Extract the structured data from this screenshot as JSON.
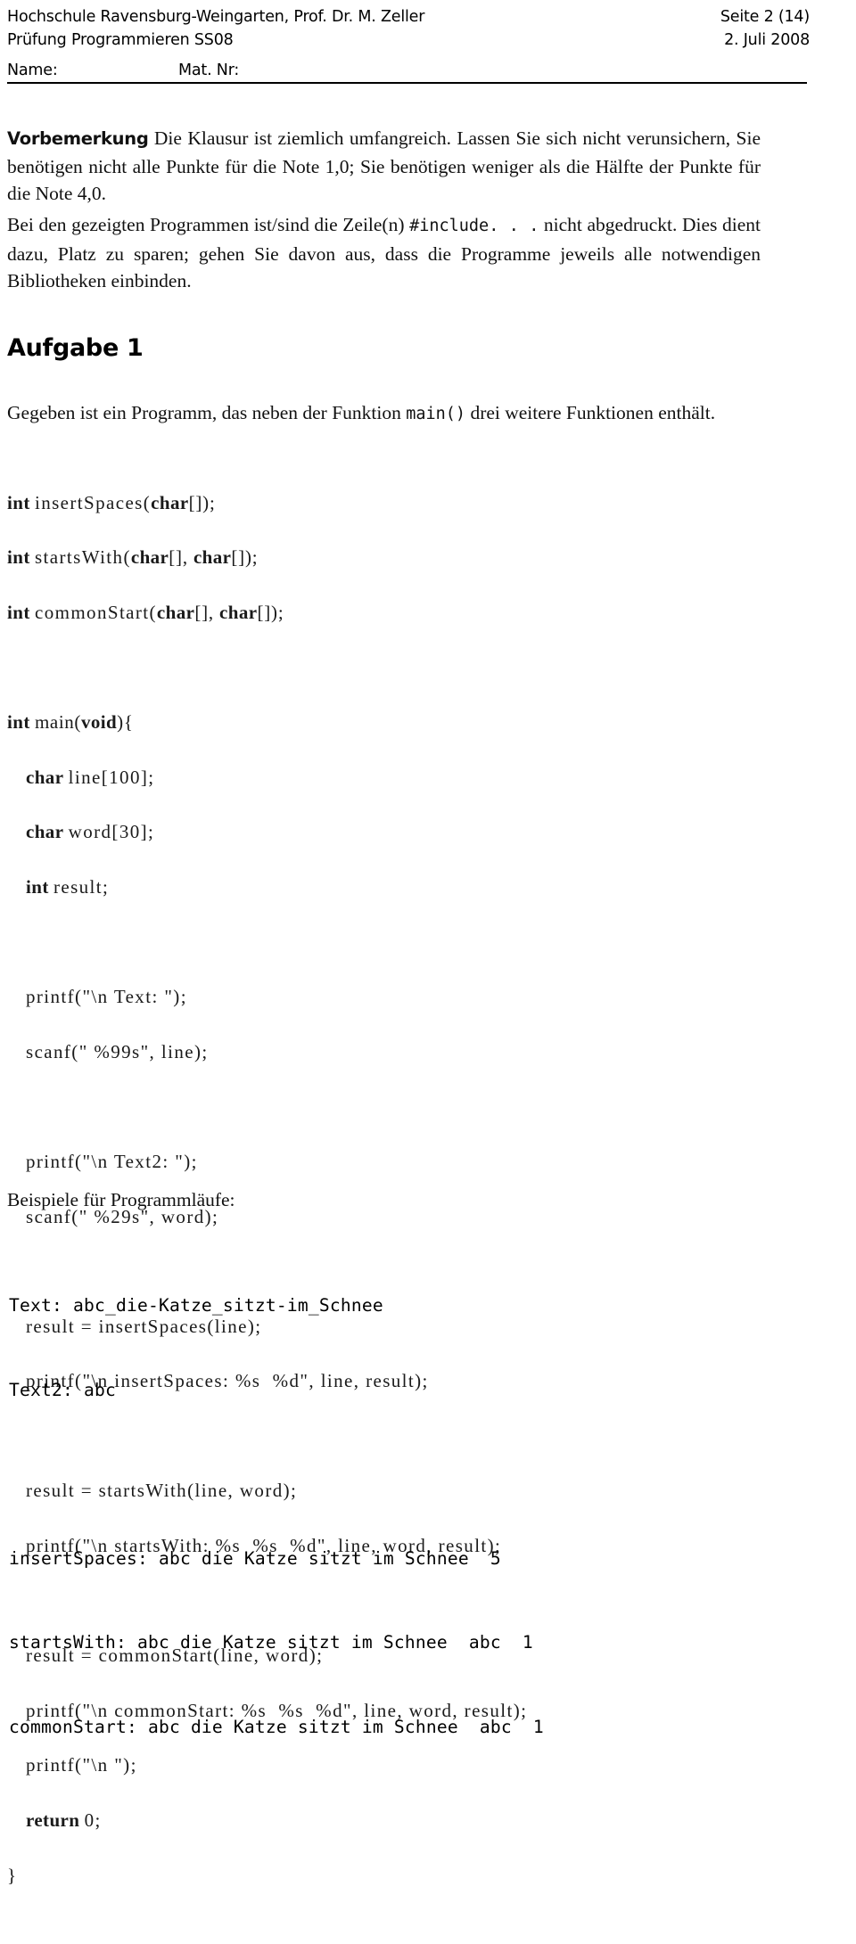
{
  "header": {
    "institution": "Hochschule Ravensburg-Weingarten, Prof. Dr. M. Zeller",
    "exam": "Prüfung Programmieren SS08",
    "page_label": "Seite 2 (14)",
    "date": "2. Juli 2008",
    "name_label": "Name:",
    "matnr_label": "Mat. Nr:"
  },
  "preface": {
    "lead": "Vorbemerkung",
    "text1": "Die Klausur ist ziemlich umfangreich. Lassen Sie sich nicht verunsichern, Sie benötigen nicht alle Punkte für die Note 1,0; Sie benötigen weniger als die Hälfte der Punkte für die Note 4,0.",
    "text2_before": "Bei den gezeigten Programmen ist/sind die Zeile(n) ",
    "text2_code": "#include",
    "text2_dots": ". . .",
    "text2_after": " nicht abgedruckt. Dies dient dazu, Platz zu sparen; gehen Sie davon aus, dass die Programme jeweils alle notwendigen Bibliotheken einbinden."
  },
  "task": {
    "title": "Aufgabe 1",
    "intro_before": "Gegeben ist ein Programm, das neben der Funktion ",
    "intro_code": "main()",
    "intro_after": " drei weitere Funktionen enthält."
  },
  "code": {
    "decl_1": {
      "kw": "int",
      "rest": "insertSpaces(",
      "kw2": "char",
      "tail": "[]);"
    },
    "decl_2": {
      "kw": "int",
      "rest": "startsWith(",
      "kw2": "char",
      "mid": "[], ",
      "kw3": "char",
      "tail": "[]);"
    },
    "decl_3": {
      "kw": "int",
      "rest": "commonStart(",
      "kw2": "char",
      "mid": "[], ",
      "kw3": "char",
      "tail": "[]);"
    },
    "main_sig": {
      "kw": "int",
      "rest": "main(",
      "kw2": "void",
      "tail": "){"
    },
    "var_line": {
      "kw": "char",
      "rest": "line[100];"
    },
    "var_word": {
      "kw": "char",
      "rest": "word[30];"
    },
    "var_result": {
      "kw": "int",
      "rest": "result;"
    },
    "printf_text": "printf(\"\\n Text: \");",
    "scanf_line": "scanf(\" %99s\", line);",
    "printf_text2": "printf(\"\\n Text2: \");",
    "scanf_word": "scanf(\" %29s\", word);",
    "call_insert": "result = insertSpaces(line);",
    "printf_insert": "printf(\"\\n insertSpaces: %s  %d\", line, result);",
    "call_starts": "result = startsWith(line, word);",
    "printf_starts": "printf(\"\\n startsWith: %s  %s  %d\", line, word, result);",
    "call_common": "result = commonStart(line, word);",
    "printf_common": "printf(\"\\n commonStart: %s  %s  %d\", line, word, result);",
    "printf_nl": "printf(\"\\n \");",
    "return_stmt": {
      "kw": "return",
      "rest": "0;"
    },
    "close_brace": "}"
  },
  "examples": {
    "caption": "Beispiele für Programmläufe:",
    "lines": [
      "Text: abc_die-Katze_sitzt-im_Schnee",
      "Text2: abc",
      "insertSpaces: abc die Katze sitzt im Schnee  5",
      "startsWith: abc die Katze sitzt im Schnee  abc  1",
      "commonStart: abc die Katze sitzt im Schnee  abc  1"
    ]
  }
}
